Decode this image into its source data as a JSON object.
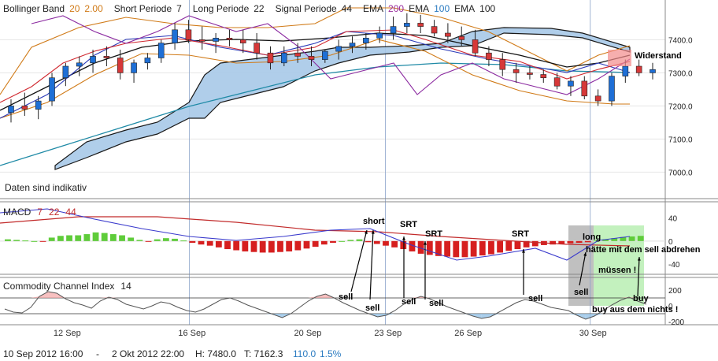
{
  "header": {
    "items": [
      {
        "text": "Bollinger Band",
        "color": "#222222"
      },
      {
        "text": "20",
        "color": "#d07a17"
      },
      {
        "text": "2.00",
        "color": "#d07a17"
      },
      {
        "text": "Short Periode",
        "color": "#222222"
      },
      {
        "text": "7",
        "color": "#222222"
      },
      {
        "text": "Long Periode",
        "color": "#222222"
      },
      {
        "text": "22",
        "color": "#222222"
      },
      {
        "text": "Signal Periode",
        "color": "#222222"
      },
      {
        "text": "44",
        "color": "#222222"
      },
      {
        "text": "EMA",
        "color": "#222222"
      },
      {
        "text": "200",
        "color": "#9a2fa0"
      },
      {
        "text": "EMA",
        "color": "#222222"
      },
      {
        "text": "100",
        "color": "#2b7bc1"
      },
      {
        "text": "EMA",
        "color": "#222222"
      },
      {
        "text": "100",
        "color": "#222222"
      }
    ]
  },
  "main_panel": {
    "note": "Daten sind indikativ",
    "annotation": "Widerstand"
  },
  "macd_panel": {
    "title": "MACD",
    "p1": "7",
    "p2": "22",
    "p3": "44"
  },
  "cci_panel": {
    "title": "Commodity Channel Index",
    "period": "14"
  },
  "footer": {
    "from": "10 Sep 2012 16:00",
    "sep": "-",
    "to": "2 Okt 2012 22:00",
    "high": "H: 7480.0",
    "last": "T: 7162.3",
    "change": "110.0",
    "pct": "1.5%"
  },
  "chart_data": {
    "type": "candlestick",
    "x_labels": [
      {
        "text": "12 Sep",
        "idx": 6
      },
      {
        "text": "16 Sep",
        "idx": 20
      },
      {
        "text": "20 Sep",
        "idx": 33
      },
      {
        "text": "23 Sep",
        "idx": 42
      },
      {
        "text": "26 Sep",
        "idx": 51
      },
      {
        "text": "30 Sep",
        "idx": 65
      }
    ],
    "main_axis": {
      "ylim": [
        6920,
        7520
      ],
      "ticks": [
        7000,
        7100,
        7200,
        7300,
        7400
      ]
    },
    "macd_axis": {
      "ylim": [
        -55,
        60
      ],
      "ticks": [
        40,
        0,
        -40
      ]
    },
    "cci_axis": {
      "ylim": [
        -220,
        320
      ],
      "ticks": [
        200,
        0,
        -200
      ],
      "ref_lines": [
        100,
        -100
      ]
    },
    "candles": [
      [
        7180,
        7220,
        7150,
        7200
      ],
      [
        7200,
        7240,
        7170,
        7190
      ],
      [
        7190,
        7230,
        7160,
        7215
      ],
      [
        7215,
        7300,
        7200,
        7285
      ],
      [
        7285,
        7330,
        7260,
        7320
      ],
      [
        7320,
        7350,
        7290,
        7330
      ],
      [
        7330,
        7370,
        7300,
        7350
      ],
      [
        7350,
        7380,
        7320,
        7345
      ],
      [
        7345,
        7370,
        7280,
        7300
      ],
      [
        7300,
        7340,
        7270,
        7330
      ],
      [
        7330,
        7360,
        7310,
        7345
      ],
      [
        7345,
        7400,
        7330,
        7390
      ],
      [
        7390,
        7450,
        7370,
        7430
      ],
      [
        7430,
        7460,
        7390,
        7400
      ],
      [
        7400,
        7440,
        7370,
        7395
      ],
      [
        7395,
        7420,
        7360,
        7405
      ],
      [
        7405,
        7430,
        7380,
        7400
      ],
      [
        7400,
        7430,
        7360,
        7390
      ],
      [
        7390,
        7420,
        7340,
        7360
      ],
      [
        7360,
        7380,
        7310,
        7330
      ],
      [
        7330,
        7380,
        7320,
        7360
      ],
      [
        7360,
        7390,
        7330,
        7350
      ],
      [
        7350,
        7380,
        7320,
        7340
      ],
      [
        7340,
        7370,
        7330,
        7365
      ],
      [
        7365,
        7400,
        7340,
        7380
      ],
      [
        7380,
        7410,
        7360,
        7390
      ],
      [
        7390,
        7420,
        7370,
        7405
      ],
      [
        7405,
        7440,
        7390,
        7420
      ],
      [
        7420,
        7470,
        7400,
        7440
      ],
      [
        7440,
        7480,
        7420,
        7450
      ],
      [
        7450,
        7475,
        7420,
        7440
      ],
      [
        7440,
        7460,
        7410,
        7420
      ],
      [
        7420,
        7450,
        7390,
        7410
      ],
      [
        7410,
        7440,
        7380,
        7400
      ],
      [
        7400,
        7430,
        7350,
        7360
      ],
      [
        7360,
        7380,
        7320,
        7340
      ],
      [
        7340,
        7360,
        7290,
        7310
      ],
      [
        7310,
        7330,
        7270,
        7300
      ],
      [
        7300,
        7320,
        7280,
        7295
      ],
      [
        7295,
        7310,
        7270,
        7285
      ],
      [
        7285,
        7300,
        7250,
        7260
      ],
      [
        7260,
        7290,
        7230,
        7275
      ],
      [
        7275,
        7290,
        7220,
        7230
      ],
      [
        7230,
        7250,
        7200,
        7215
      ],
      [
        7215,
        7300,
        7200,
        7290
      ],
      [
        7290,
        7340,
        7270,
        7320
      ],
      [
        7320,
        7340,
        7290,
        7300
      ],
      [
        7300,
        7330,
        7280,
        7310
      ]
    ],
    "macd_hist": [
      3,
      2,
      1,
      0,
      -1,
      6,
      9,
      10,
      10,
      12,
      15,
      14,
      12,
      10,
      6,
      2,
      -1,
      3,
      5,
      4,
      1,
      -3,
      -6,
      -8,
      -11,
      -14,
      -16,
      -18,
      -19,
      -20,
      -20,
      -19,
      -18,
      -16,
      -13,
      -10,
      -6,
      -3,
      0,
      2,
      3,
      -2,
      -5,
      -8,
      -11,
      -14,
      -18,
      -22,
      -24,
      -26,
      -27,
      -28,
      -28,
      -27,
      -25,
      -23,
      -20,
      -17,
      -14,
      -11,
      -9,
      -7,
      -6,
      -5,
      -4,
      -3,
      -2,
      1,
      3,
      5,
      7,
      8,
      9
    ],
    "cci": [
      -40,
      -80,
      -90,
      -20,
      120,
      180,
      160,
      90,
      40,
      10,
      -30,
      60,
      110,
      80,
      20,
      -10,
      -40,
      0,
      50,
      30,
      -20,
      -60,
      -80,
      -40,
      20,
      80,
      100,
      60,
      10,
      -30,
      -70,
      -110,
      -150,
      -100,
      -20,
      60,
      120,
      150,
      100,
      40,
      -10,
      -60,
      -100,
      -140,
      -120,
      -60,
      20,
      80,
      120,
      90,
      40,
      -10,
      -50,
      -90,
      -130,
      -160,
      -140,
      -80,
      -20,
      40,
      80,
      60,
      20,
      -20,
      -40,
      -60,
      -120,
      -170,
      -130,
      -60,
      10,
      70,
      110,
      60,
      20
    ]
  }
}
